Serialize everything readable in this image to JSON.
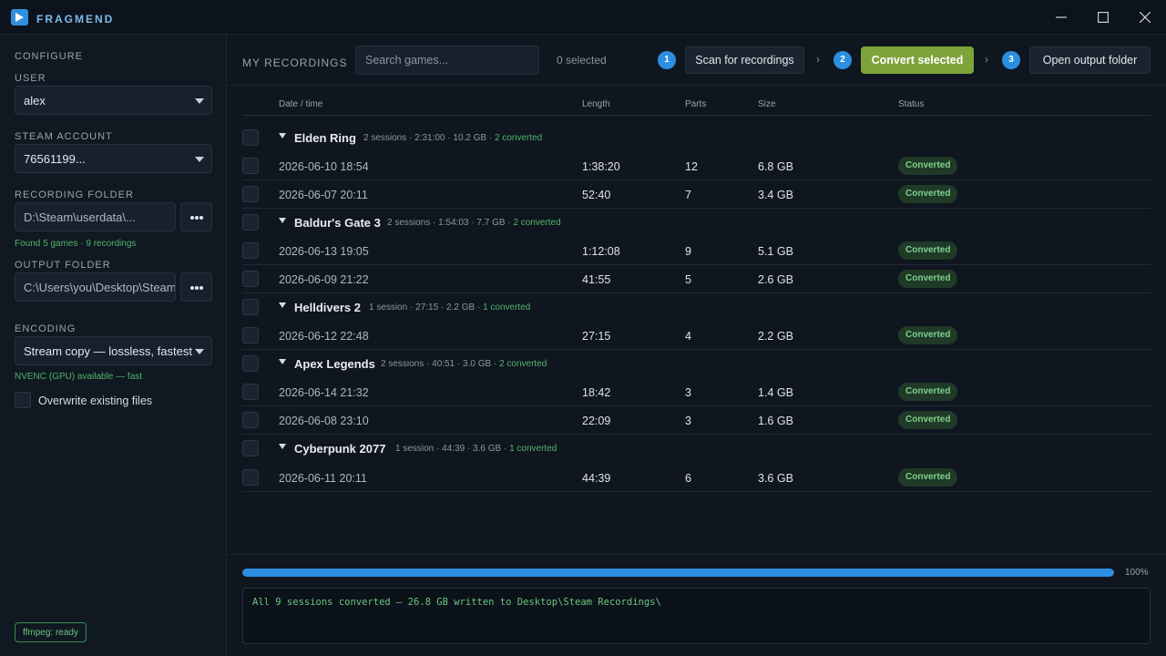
{
  "app": {
    "title": "FRAGMEND"
  },
  "sidebar": {
    "configure_label": "CONFIGURE",
    "user_label": "USER",
    "user_value": "alex",
    "steam_label": "STEAM ACCOUNT",
    "steam_value": "76561199...",
    "recording_label": "RECORDING FOLDER",
    "recording_value": "D:\\Steam\\userdata\\...",
    "recording_hint": "Found 5 games · 9 recordings",
    "output_label": "OUTPUT FOLDER",
    "output_value": "C:\\Users\\you\\Desktop\\Steam...",
    "encoding_label": "ENCODING",
    "encoding_value": "Stream copy — lossless, fastest",
    "encoding_hint": "NVENC (GPU) available — fast",
    "overwrite_label": "Overwrite existing files",
    "ffmpeg_status": "ffmpeg: ready"
  },
  "toolbar": {
    "section_title": "MY RECORDINGS",
    "search_placeholder": "Search games...",
    "selected_count": "0 selected",
    "step1": "1",
    "scan_label": "Scan for recordings",
    "step2": "2",
    "convert_label": "Convert selected",
    "step3": "3",
    "open_label": "Open output folder",
    "chevron": "›"
  },
  "table": {
    "headers": {
      "date": "Date / time",
      "length": "Length",
      "parts": "Parts",
      "size": "Size",
      "status": "Status"
    },
    "groups": [
      {
        "name": "Elden Ring",
        "meta": "2 sessions · 2:31:00 · 10.2 GB",
        "sep": "·",
        "converted": "2 converted",
        "rows": [
          {
            "date": "2026-06-10  18:54",
            "length": "1:38:20",
            "parts": "12",
            "size": "6.8 GB",
            "status": "Converted"
          },
          {
            "date": "2026-06-07  20:11",
            "length": "52:40",
            "parts": "7",
            "size": "3.4 GB",
            "status": "Converted"
          }
        ]
      },
      {
        "name": "Baldur's Gate 3",
        "meta": "2 sessions · 1:54:03 · 7.7 GB",
        "sep": "·",
        "converted": "2 converted",
        "rows": [
          {
            "date": "2026-06-13  19:05",
            "length": "1:12:08",
            "parts": "9",
            "size": "5.1 GB",
            "status": "Converted"
          },
          {
            "date": "2026-06-09  21:22",
            "length": "41:55",
            "parts": "5",
            "size": "2.6 GB",
            "status": "Converted"
          }
        ]
      },
      {
        "name": "Helldivers 2",
        "meta": "1 session · 27:15 · 2.2 GB",
        "sep": "·",
        "converted": "1 converted",
        "rows": [
          {
            "date": "2026-06-12  22:48",
            "length": "27:15",
            "parts": "4",
            "size": "2.2 GB",
            "status": "Converted"
          }
        ]
      },
      {
        "name": "Apex Legends",
        "meta": "2 sessions · 40:51 · 3.0 GB",
        "sep": "·",
        "converted": "2 converted",
        "rows": [
          {
            "date": "2026-06-14  21:32",
            "length": "18:42",
            "parts": "3",
            "size": "1.4 GB",
            "status": "Converted"
          },
          {
            "date": "2026-06-08  23:10",
            "length": "22:09",
            "parts": "3",
            "size": "1.6 GB",
            "status": "Converted"
          }
        ]
      },
      {
        "name": "Cyberpunk 2077",
        "meta": "1 session · 44:39 · 3.6 GB",
        "sep": "·",
        "converted": "1 converted",
        "rows": [
          {
            "date": "2026-06-11  20:11",
            "length": "44:39",
            "parts": "6",
            "size": "3.6 GB",
            "status": "Converted"
          }
        ]
      }
    ]
  },
  "progress": {
    "value": 1.0,
    "label": "100%"
  },
  "log": {
    "message": "All 9 sessions converted — 26.8 GB written to Desktop\\Steam Recordings\\"
  },
  "colors": {
    "accent": "#2b8ee0",
    "primary_button": "#7da33a",
    "success": "#52b56a",
    "background": "#0f1620"
  },
  "icons": {
    "logo": "play-icon",
    "minimize": "minimize-icon",
    "maximize": "maximize-icon",
    "close": "close-icon"
  }
}
